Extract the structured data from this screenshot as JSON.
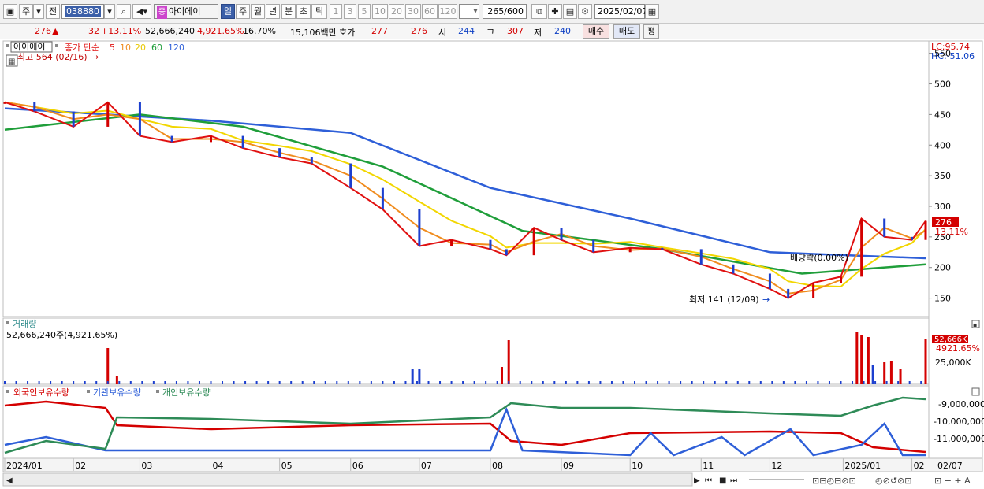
{
  "toolbar": {
    "market_label": "주",
    "all_label": "전",
    "stock_code": "038880",
    "stock_badge": "종",
    "stock_name": "아이에이",
    "periods": [
      "일",
      "주",
      "월",
      "년",
      "분",
      "초",
      "틱"
    ],
    "active_period": "일",
    "intervals": [
      "1",
      "3",
      "5",
      "10",
      "20",
      "30",
      "60",
      "120"
    ],
    "count_display": "265/600",
    "date": "2025/02/07"
  },
  "quote": {
    "price": "276",
    "change": "32",
    "change_pct": "+13.11%",
    "volume": "52,666,240",
    "volume_ratio": "4,921.65%",
    "turnover": "16.70%",
    "amount": "15,106백만",
    "hoga_label": "호가",
    "ask": "277",
    "bid": "276",
    "open_label": "시",
    "open": "244",
    "high_label": "고",
    "high": "307",
    "low_label": "저",
    "low": "240",
    "buy_label": "매수",
    "sell_label": "매도",
    "eval_label": "평"
  },
  "price_panel": {
    "stock_label": "아이에이",
    "legend_prefix": "종가 단순",
    "ma_periods": [
      "5",
      "10",
      "20",
      "60",
      "120"
    ],
    "ma_colors": [
      "#e01010",
      "#f08c1e",
      "#f2d600",
      "#1f9e3a",
      "#2e5fd8"
    ],
    "high_annotation": "최고 564 (02/16)",
    "low_annotation": "최저 141 (12/09)",
    "dividend_label": "배당락(0.00%)",
    "lc_label": "LC:95.74",
    "hc_label": "HC:-51.06",
    "y_ticks": [
      "550",
      "500",
      "450",
      "400",
      "350",
      "300",
      "250",
      "200",
      "150"
    ],
    "current_badge": "276",
    "current_pct_badge": "13.11%"
  },
  "volume_panel": {
    "title": "거래량",
    "value_label": "52,666,240주(4,921.65%)",
    "y_tick": "25,000K",
    "badge_value": "52,666K",
    "badge_pct": "4921.65%"
  },
  "holding_panel": {
    "series_labels": [
      "외국인보유수량",
      "기관보유수량",
      "개인보유수량"
    ],
    "series_colors": [
      "#d40000",
      "#2e5fd8",
      "#2e8b57"
    ],
    "y_ticks": [
      "-9,000,000",
      "-10,000,000",
      "-11,000,000"
    ]
  },
  "x_axis": {
    "labels": [
      "2024/01",
      "02",
      "03",
      "04",
      "05",
      "06",
      "07",
      "08",
      "09",
      "10",
      "11",
      "12",
      "2025/01",
      "02",
      "02/07"
    ]
  },
  "chart_data": {
    "type": "line",
    "y_range": [
      125,
      565
    ],
    "close_series": [
      {
        "date": "2024-01-02",
        "value": 470
      },
      {
        "date": "2024-01-15",
        "value": 455
      },
      {
        "date": "2024-02-01",
        "value": 430
      },
      {
        "date": "2024-02-16",
        "value": 470
      },
      {
        "date": "2024-03-01",
        "value": 415
      },
      {
        "date": "2024-03-15",
        "value": 405
      },
      {
        "date": "2024-04-01",
        "value": 415
      },
      {
        "date": "2024-04-15",
        "value": 395
      },
      {
        "date": "2024-05-01",
        "value": 380
      },
      {
        "date": "2024-05-15",
        "value": 370
      },
      {
        "date": "2024-06-01",
        "value": 330
      },
      {
        "date": "2024-06-15",
        "value": 295
      },
      {
        "date": "2024-07-01",
        "value": 235
      },
      {
        "date": "2024-07-15",
        "value": 245
      },
      {
        "date": "2024-08-01",
        "value": 230
      },
      {
        "date": "2024-08-08",
        "value": 220
      },
      {
        "date": "2024-08-20",
        "value": 265
      },
      {
        "date": "2024-09-01",
        "value": 245
      },
      {
        "date": "2024-09-15",
        "value": 225
      },
      {
        "date": "2024-10-01",
        "value": 232
      },
      {
        "date": "2024-10-15",
        "value": 230
      },
      {
        "date": "2024-11-01",
        "value": 205
      },
      {
        "date": "2024-11-15",
        "value": 190
      },
      {
        "date": "2024-12-01",
        "value": 165
      },
      {
        "date": "2024-12-09",
        "value": 150
      },
      {
        "date": "2024-12-20",
        "value": 175
      },
      {
        "date": "2025-01-01",
        "value": 185
      },
      {
        "date": "2025-01-10",
        "value": 280
      },
      {
        "date": "2025-01-20",
        "value": 250
      },
      {
        "date": "2025-02-01",
        "value": 245
      },
      {
        "date": "2025-02-07",
        "value": 276
      }
    ],
    "ma120_series": [
      {
        "date": "2024-01-02",
        "value": 460
      },
      {
        "date": "2024-04-01",
        "value": 440
      },
      {
        "date": "2024-06-01",
        "value": 420
      },
      {
        "date": "2024-08-01",
        "value": 330
      },
      {
        "date": "2024-10-01",
        "value": 280
      },
      {
        "date": "2024-12-01",
        "value": 225
      },
      {
        "date": "2025-02-07",
        "value": 215
      }
    ],
    "ma60_series": [
      {
        "date": "2024-01-02",
        "value": 425
      },
      {
        "date": "2024-03-01",
        "value": 450
      },
      {
        "date": "2024-04-15",
        "value": 430
      },
      {
        "date": "2024-06-15",
        "value": 365
      },
      {
        "date": "2024-08-15",
        "value": 260
      },
      {
        "date": "2024-10-15",
        "value": 230
      },
      {
        "date": "2024-12-15",
        "value": 190
      },
      {
        "date": "2025-02-07",
        "value": 205
      }
    ]
  }
}
